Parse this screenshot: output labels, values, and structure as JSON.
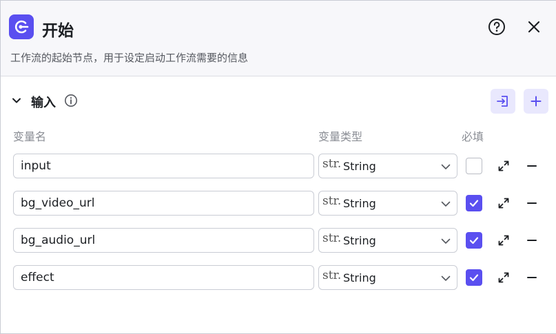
{
  "header": {
    "title": "开始",
    "description": "工作流的起始节点，用于设定启动工作流需要的信息",
    "icons": {
      "app": "start-node-icon",
      "help": "help-circle-icon",
      "close": "close-icon"
    }
  },
  "section": {
    "title": "输入",
    "icons": {
      "collapse": "chevron-down-icon",
      "info": "info-icon",
      "import": "import-icon",
      "add": "plus-icon"
    }
  },
  "columns": {
    "name": "变量名",
    "type": "变量类型",
    "required": "必填"
  },
  "rows": [
    {
      "name": "input",
      "type_badge": "str.",
      "type": "String",
      "required": false
    },
    {
      "name": "bg_video_url",
      "type_badge": "str.",
      "type": "String",
      "required": true
    },
    {
      "name": "bg_audio_url",
      "type_badge": "str.",
      "type": "String",
      "required": true
    },
    {
      "name": "effect",
      "type_badge": "str.",
      "type": "String",
      "required": true
    }
  ],
  "colors": {
    "accent": "#5a4ff0",
    "accent_light": "#e9e8fd",
    "border": "#c9ccd4"
  }
}
